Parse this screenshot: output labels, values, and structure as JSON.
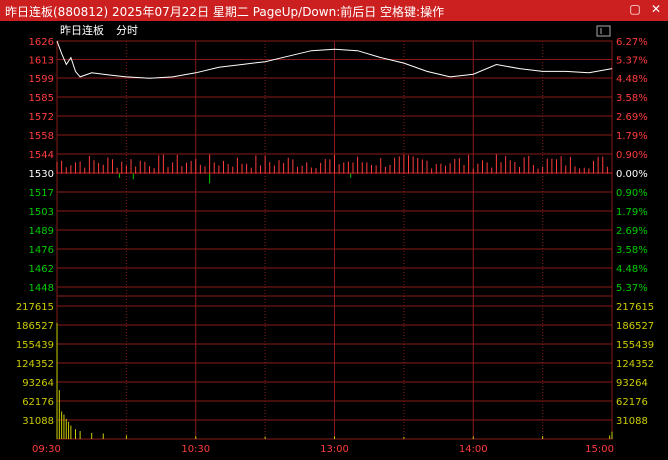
{
  "window": {
    "title": "昨日连板(880812) 2025年07月22日 星期二 PageUp/Down:前后日 空格键:操作",
    "min_icon": "minimize-icon",
    "close_icon": "close-icon"
  },
  "chart_header": {
    "name": "昨日连板",
    "mode": "分时",
    "mode_toggle_icon": "window-toggle-icon"
  },
  "colors": {
    "up": "#ff3c3c",
    "down": "#00cc00",
    "neutral": "#ffffff",
    "grid": "#8b1a1a",
    "volume": "#cccc00",
    "time": "#ff3c3c"
  },
  "chart_data": [
    {
      "type": "line",
      "panel": "price",
      "base_value": 1530,
      "y_ticks": [
        1626,
        1613,
        1599,
        1585,
        1572,
        1558,
        1544,
        1530,
        1517,
        1503,
        1489,
        1476,
        1462,
        1448
      ],
      "y_tick_labels": [
        "1626",
        "1613",
        "1599",
        "1585",
        "1572",
        "1558",
        "1544",
        "1530",
        "1517",
        "1503",
        "1489",
        "1476",
        "1462",
        "1448"
      ],
      "pct_labels": [
        "6.27%",
        "5.37%",
        "4.48%",
        "3.58%",
        "2.69%",
        "1.79%",
        "0.90%",
        "0.00%",
        "0.90%",
        "1.79%",
        "2.69%",
        "3.58%",
        "4.48%",
        "5.37%"
      ],
      "ylim": [
        1441,
        1633
      ],
      "x_minutes": [
        0,
        2,
        4,
        6,
        8,
        10,
        15,
        20,
        25,
        30,
        40,
        50,
        60,
        70,
        80,
        90,
        100,
        110,
        120,
        130,
        140,
        150,
        160,
        170,
        180,
        190,
        200,
        210,
        220,
        230,
        240
      ],
      "price": [
        1626,
        1617,
        1609,
        1614,
        1604,
        1600,
        1603,
        1602,
        1601,
        1600,
        1599,
        1600,
        1603,
        1607,
        1609,
        1611,
        1615,
        1619,
        1620,
        1619,
        1614,
        1610,
        1604,
        1600,
        1602,
        1609,
        1606,
        1604,
        1604,
        1603,
        1606
      ]
    },
    {
      "type": "bar",
      "panel": "breadth",
      "x_minutes_range": [
        0,
        240
      ],
      "samples": 120,
      "up_max_value": 1544,
      "down_example_minutes": [
        27,
        33,
        66,
        127
      ],
      "down_example_values": [
        1527,
        1526,
        1523,
        1527
      ]
    },
    {
      "type": "bar",
      "panel": "volume",
      "y_ticks": [
        217615,
        186527,
        155439,
        124352,
        93264,
        62176,
        31088
      ],
      "y_tick_labels": [
        "217615",
        "186527",
        "155439",
        "124352",
        "93264",
        "62176",
        "31088"
      ],
      "ylim": [
        0,
        232000
      ],
      "x_minutes": [
        0,
        1,
        2,
        3,
        4,
        5,
        6,
        8,
        10,
        15,
        20,
        30,
        60,
        90,
        120,
        150,
        180,
        210,
        239,
        240
      ],
      "volume": [
        190000,
        80000,
        45000,
        40000,
        33000,
        28000,
        22000,
        16000,
        13000,
        10000,
        9000,
        6000,
        4500,
        4000,
        4500,
        3500,
        4000,
        5000,
        6000,
        12000
      ]
    }
  ],
  "time_axis": {
    "labels": [
      "09:30",
      "10:30",
      "13:00",
      "14:00",
      "15:00"
    ],
    "minutes": [
      0,
      60,
      120,
      180,
      240
    ]
  }
}
